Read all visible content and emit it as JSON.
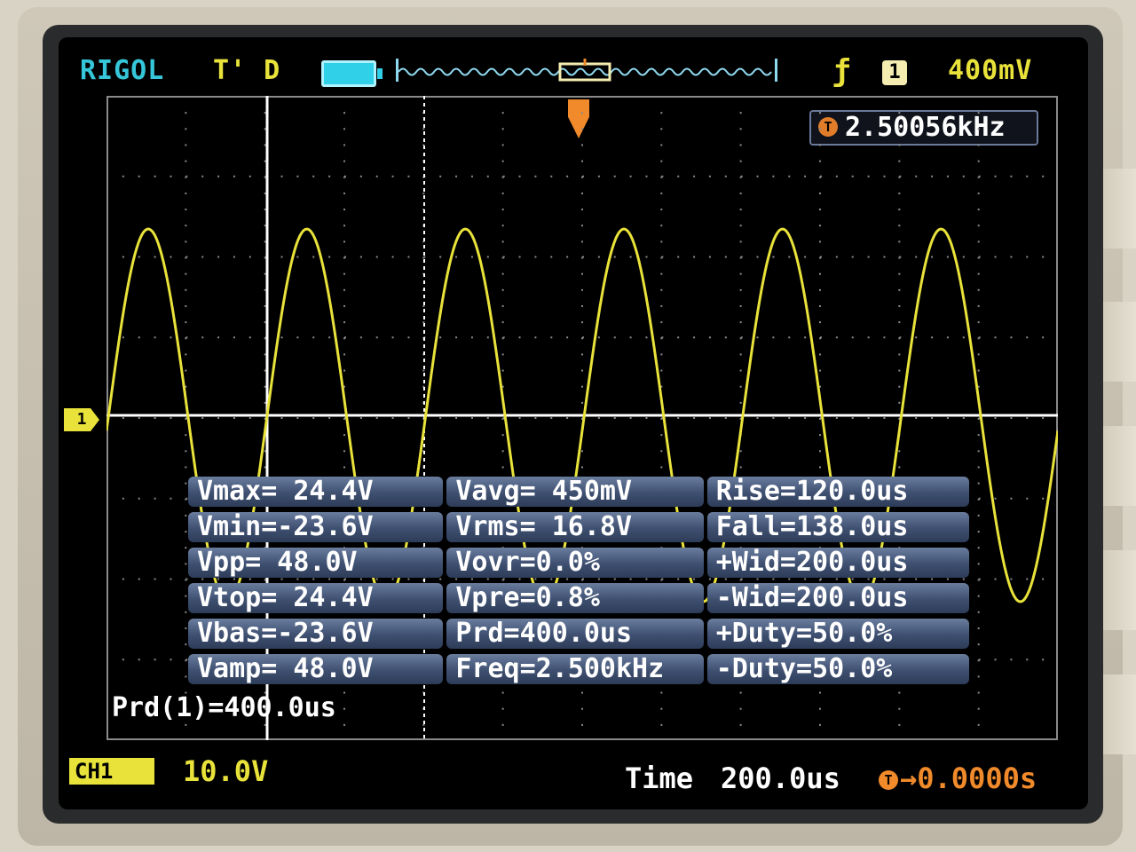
{
  "header": {
    "brand": "RIGOL",
    "trigger_status": "T' D",
    "trigger_edge_icon": "rising-edge-icon",
    "channel_badge": "1",
    "trigger_level": "400mV"
  },
  "frequency_counter": {
    "icon_label": "T",
    "value": "2.50056kHz"
  },
  "channel_marker": {
    "label": "1"
  },
  "measurements": [
    [
      "Vmax= 24.4V",
      "Vavg= 450mV",
      "Rise=120.0us"
    ],
    [
      "Vmin=-23.6V",
      "Vrms= 16.8V",
      "Fall=138.0us"
    ],
    [
      "Vpp= 48.0V",
      "Vovr=0.0%",
      "+Wid=200.0us"
    ],
    [
      "Vtop= 24.4V",
      "Vpre=0.8%",
      "-Wid=200.0us"
    ],
    [
      "Vbas=-23.6V",
      "Prd=400.0us",
      "+Duty=50.0%"
    ],
    [
      "Vamp= 48.0V",
      "Freq=2.500kHz",
      "-Duty=50.0%"
    ]
  ],
  "cursor_readout": "Prd(1)=400.0us",
  "footer": {
    "channel_icon_label": "CH1",
    "channel_scale": "10.0V",
    "time_label": "Time",
    "time_value": "200.0us",
    "offset_icon_label": "T",
    "offset_value": "→0.0000s"
  },
  "colors": {
    "trace": "#e8e23a",
    "brand": "#36c6d9",
    "trigger": "#f08a2a",
    "grid": "#8a8a8a"
  }
}
